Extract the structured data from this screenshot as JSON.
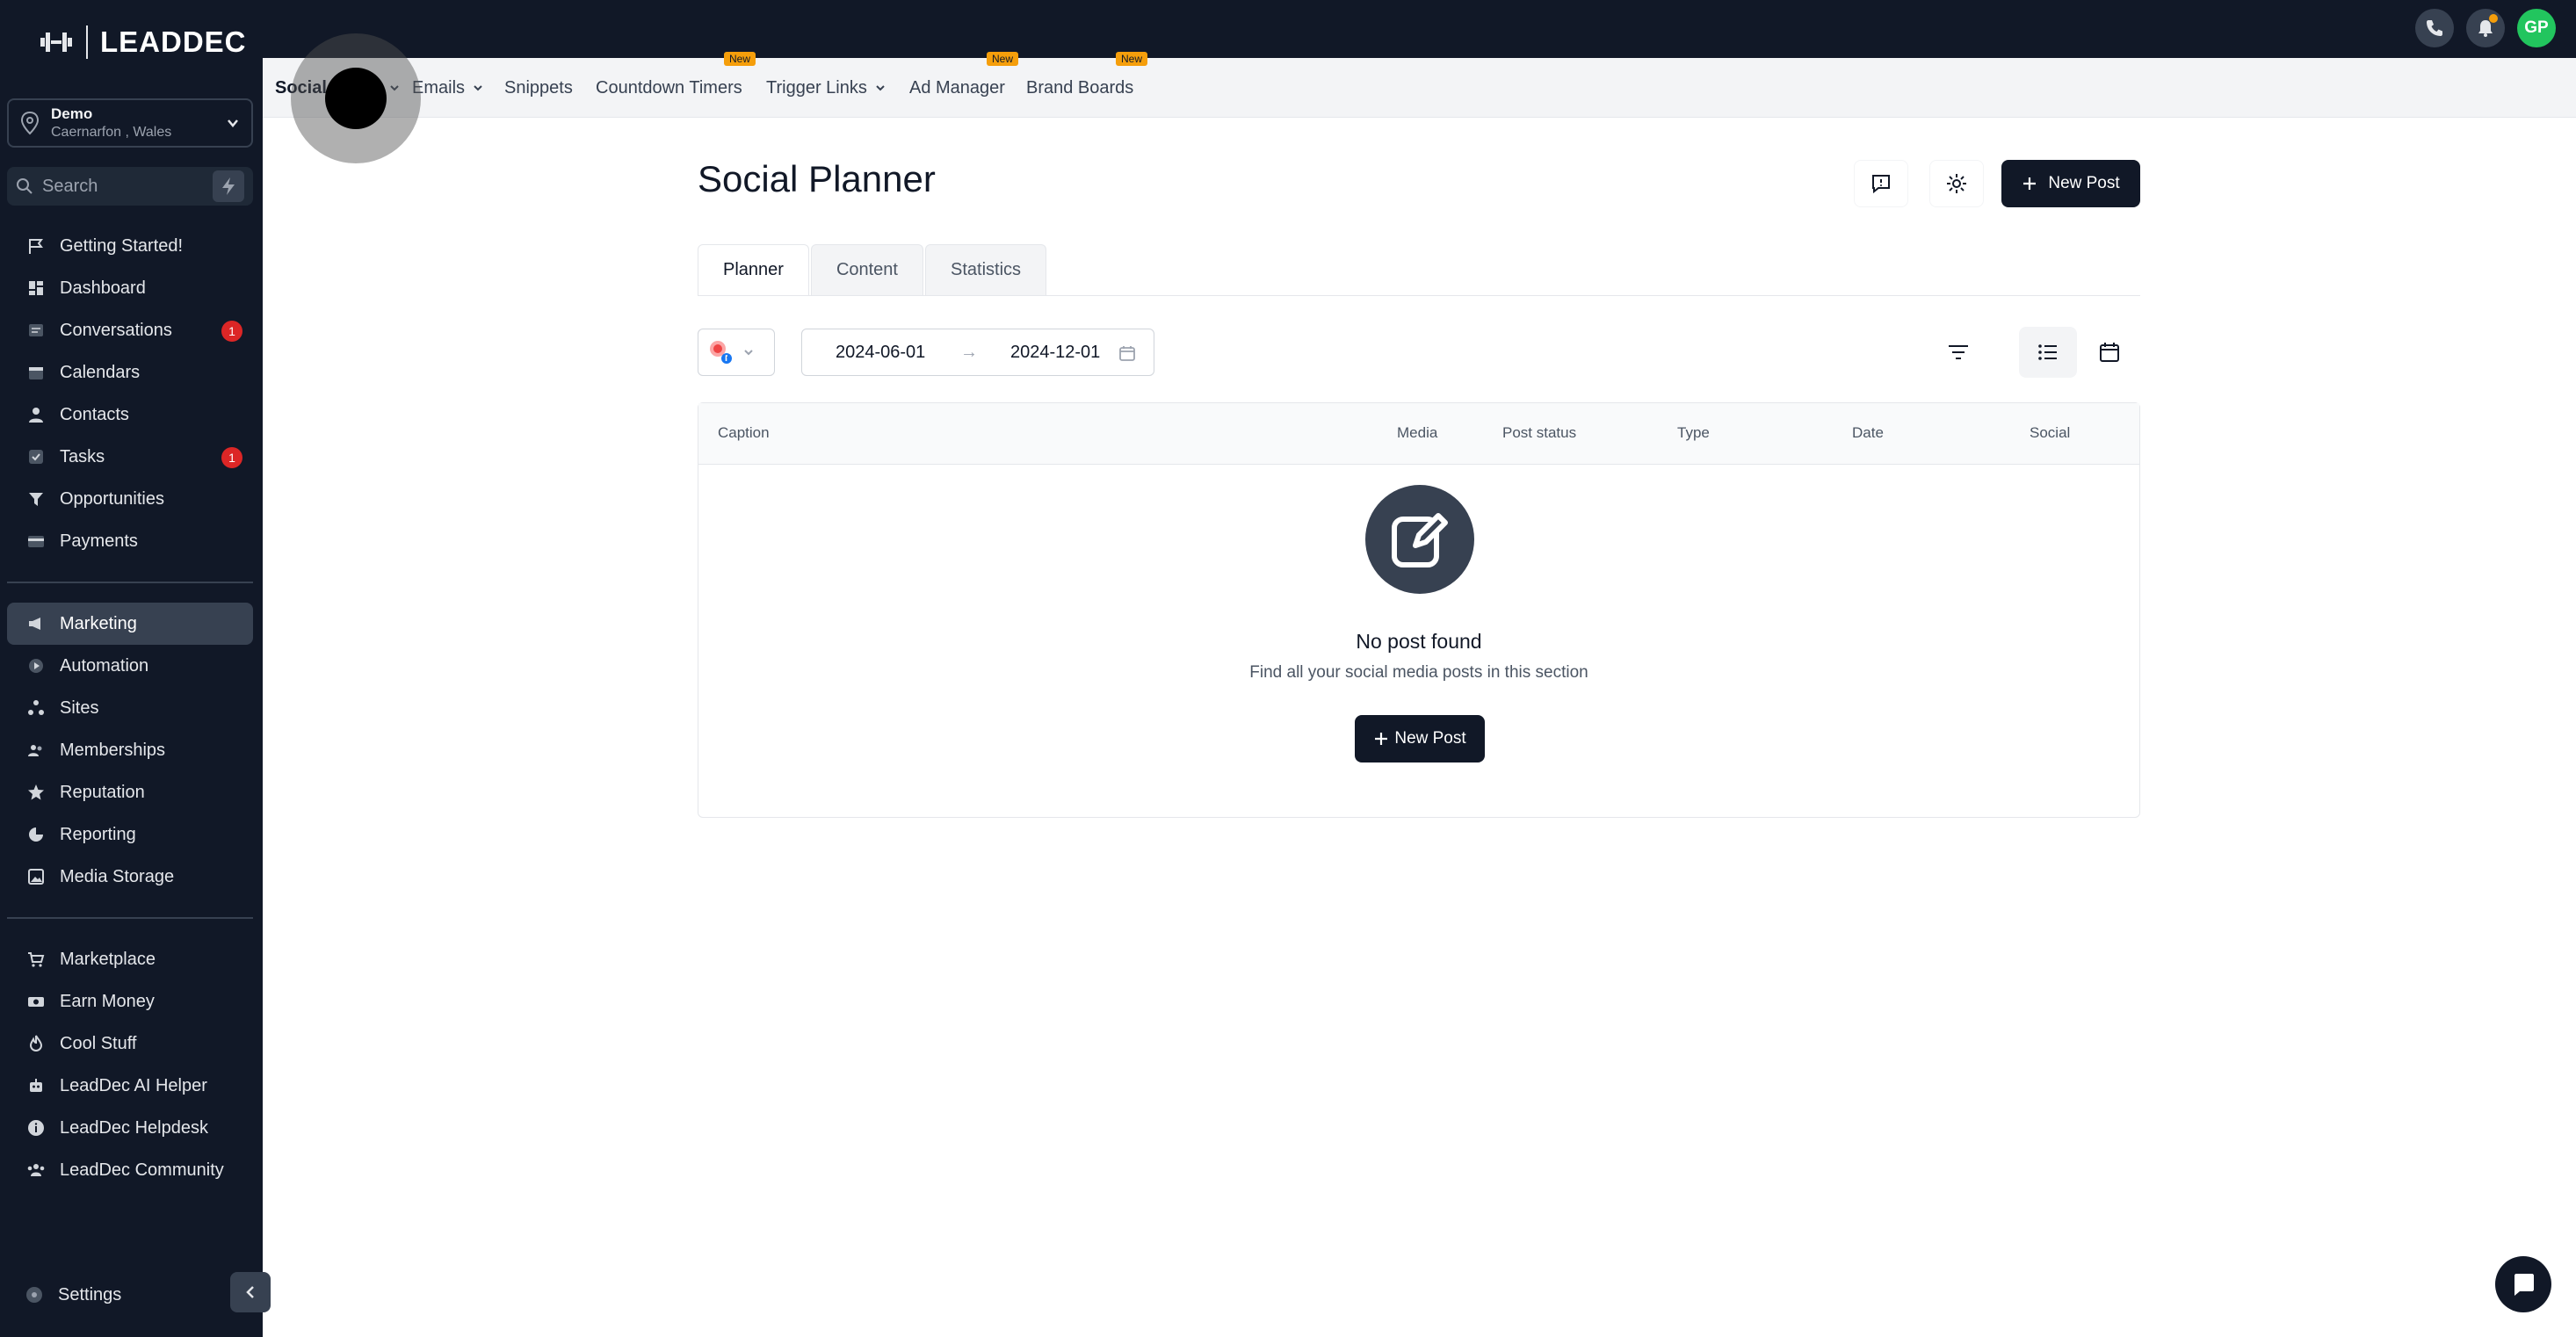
{
  "brand": {
    "name": "LEADDEC"
  },
  "account": {
    "name": "Demo",
    "location": "Caernarfon , Wales"
  },
  "search": {
    "placeholder": "Search"
  },
  "nav_group1": [
    {
      "label": "Getting Started!",
      "icon": "flag-icon"
    },
    {
      "label": "Dashboard",
      "icon": "dashboard-icon"
    },
    {
      "label": "Conversations",
      "icon": "chat-icon",
      "badge": "1"
    },
    {
      "label": "Calendars",
      "icon": "calendar-icon"
    },
    {
      "label": "Contacts",
      "icon": "user-icon"
    },
    {
      "label": "Tasks",
      "icon": "check-icon",
      "badge": "1"
    },
    {
      "label": "Opportunities",
      "icon": "funnel-icon"
    },
    {
      "label": "Payments",
      "icon": "card-icon"
    }
  ],
  "nav_group2": [
    {
      "label": "Marketing",
      "icon": "megaphone-icon",
      "active": true
    },
    {
      "label": "Automation",
      "icon": "automation-icon"
    },
    {
      "label": "Sites",
      "icon": "sites-icon"
    },
    {
      "label": "Memberships",
      "icon": "members-icon"
    },
    {
      "label": "Reputation",
      "icon": "star-icon"
    },
    {
      "label": "Reporting",
      "icon": "chart-icon"
    },
    {
      "label": "Media Storage",
      "icon": "image-icon"
    }
  ],
  "nav_group3": [
    {
      "label": "Marketplace",
      "icon": "cart-icon"
    },
    {
      "label": "Earn Money",
      "icon": "money-icon"
    },
    {
      "label": "Cool Stuff",
      "icon": "fire-icon"
    },
    {
      "label": "LeadDec AI Helper",
      "icon": "robot-icon"
    },
    {
      "label": "LeadDec Helpdesk",
      "icon": "info-icon"
    },
    {
      "label": "LeadDec Community",
      "icon": "community-icon"
    }
  ],
  "settings": {
    "label": "Settings"
  },
  "topbar": {
    "avatar_initials": "GP"
  },
  "subnav": [
    {
      "label": "Social Planner",
      "display": "Social",
      "active": true,
      "dropdown": true
    },
    {
      "label": "Emails",
      "dropdown": true
    },
    {
      "label": "Snippets"
    },
    {
      "label": "Countdown Timers",
      "new": "New"
    },
    {
      "label": "Trigger Links",
      "dropdown": true
    },
    {
      "label": "Ad Manager",
      "new": "New"
    },
    {
      "label": "Brand Boards",
      "new": "New"
    }
  ],
  "page": {
    "title": "Social Planner",
    "new_post_label": "New Post",
    "tabs": [
      "Planner",
      "Content",
      "Statistics"
    ],
    "active_tab": "Planner",
    "date_from": "2024-06-01",
    "date_to": "2024-12-01",
    "date_arrow": "→"
  },
  "table": {
    "columns": [
      "Caption",
      "Media",
      "Post status",
      "Type",
      "Date",
      "Social"
    ],
    "empty_title": "No post found",
    "empty_subtitle": "Find all your social media posts in this section",
    "empty_button": "New Post"
  },
  "colors": {
    "sidebar_bg": "#111827",
    "badge": "#dc2626",
    "new_tag": "#f59e0b",
    "avatar": "#22c55e",
    "primary_button": "#111827"
  }
}
